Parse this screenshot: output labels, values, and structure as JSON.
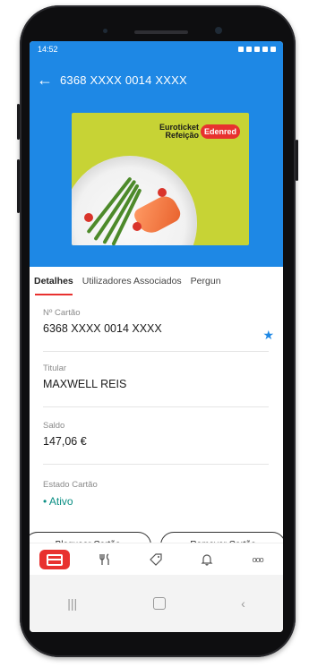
{
  "status_bar": {
    "time": "14:52"
  },
  "app_bar": {
    "title": "6368 XXXX 0014 XXXX"
  },
  "card_image": {
    "brand_line1": "Euroticket",
    "brand_line2": "Refeição",
    "brand_logo": "Edenred"
  },
  "tabs": [
    {
      "label": "Detalhes",
      "active": true
    },
    {
      "label": "Utilizadores Associados",
      "active": false
    },
    {
      "label": "Pergun",
      "active": false
    }
  ],
  "fields": {
    "card_number": {
      "label": "Nº Cartão",
      "value": "6368 XXXX 0014 XXXX"
    },
    "holder": {
      "label": "Titular",
      "value": "MAXWELL REIS"
    },
    "balance": {
      "label": "Saldo",
      "value": "147,06 €"
    },
    "card_state": {
      "label": "Estado Cartão",
      "value": "• Ativo"
    }
  },
  "actions": {
    "block_label": "Bloquear Cartão",
    "remove_label": "Remover Cartão"
  },
  "bottom_nav": [
    {
      "icon": "card-icon",
      "active": true
    },
    {
      "icon": "restaurant-icon",
      "active": false
    },
    {
      "icon": "tag-icon",
      "active": false
    },
    {
      "icon": "bell-icon",
      "active": false
    },
    {
      "icon": "more-icon",
      "active": false,
      "glyph": "ooo"
    }
  ],
  "colors": {
    "primary": "#1e88e5",
    "accent": "#e8312f",
    "active_status": "#0b8f84",
    "card_green": "#c7d335"
  }
}
